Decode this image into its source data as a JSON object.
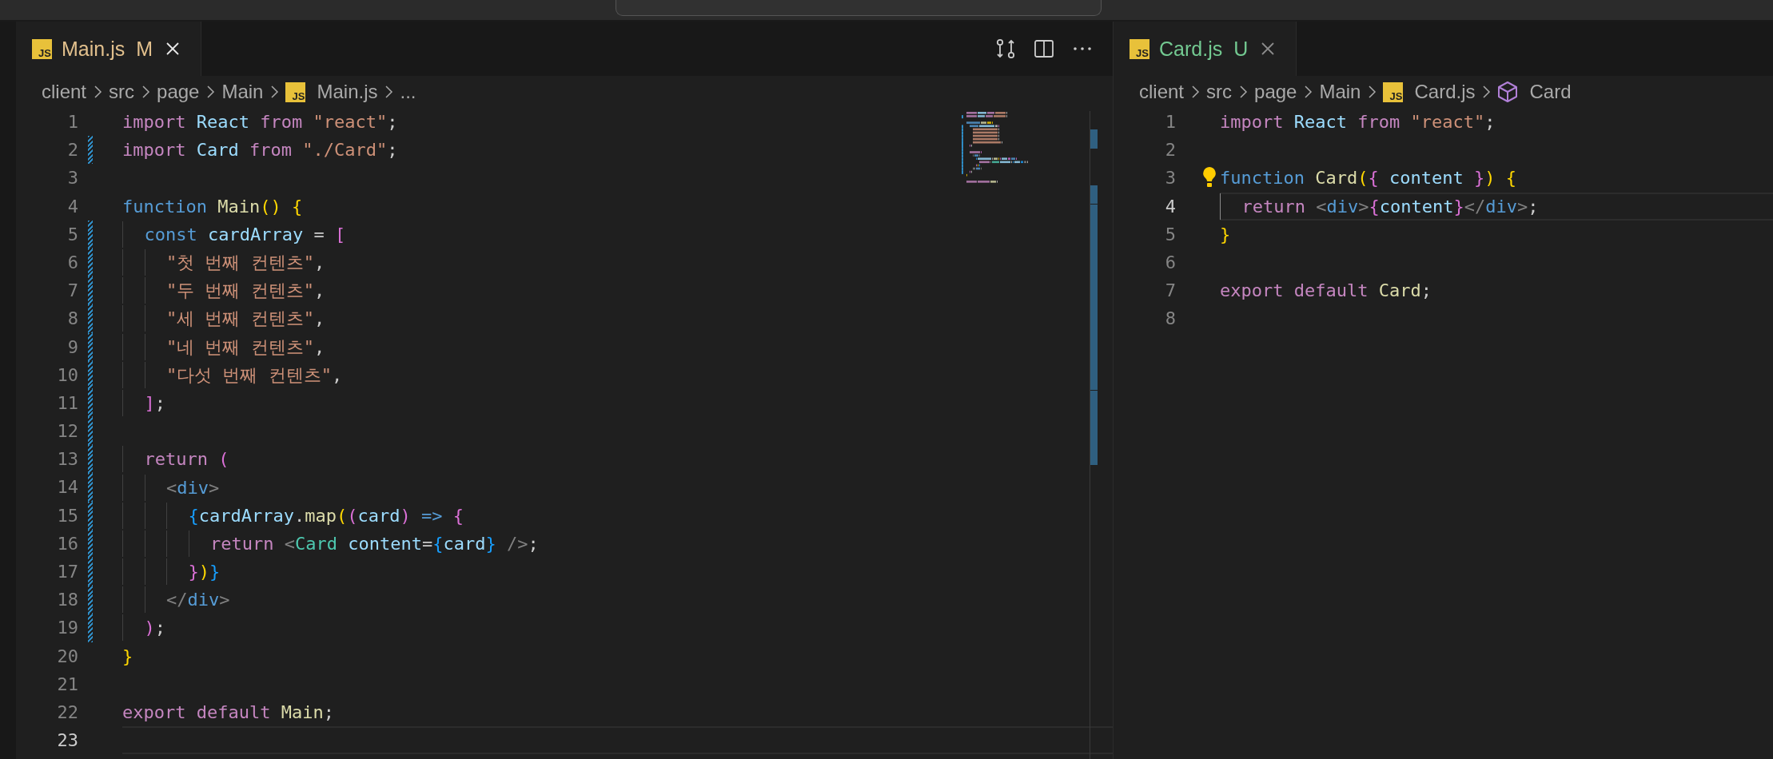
{
  "editor_groups": [
    {
      "focused": true,
      "tab": {
        "icon": "JS",
        "label": "Main.js",
        "status": "M",
        "kind": "modified",
        "selected": true
      },
      "actions": [
        {
          "kind": "compare"
        },
        {
          "kind": "split"
        },
        {
          "kind": "more"
        }
      ],
      "breadcrumbs": [
        {
          "kind": "folder",
          "label": "client"
        },
        {
          "kind": "folder",
          "label": "src"
        },
        {
          "kind": "folder",
          "label": "page"
        },
        {
          "kind": "folder",
          "label": "Main"
        },
        {
          "kind": "file",
          "icon": "JS",
          "label": "Main.js"
        },
        {
          "kind": "more",
          "label": "..."
        }
      ],
      "lines": [
        {
          "number": "1",
          "tokens": [
            {
              "kind": "kw",
              "text": "import "
            },
            {
              "kind": "var",
              "text": "React "
            },
            {
              "kind": "kw",
              "text": "from "
            },
            {
              "kind": "str",
              "text": "\"react\""
            },
            {
              "kind": "p",
              "text": ";"
            }
          ]
        },
        {
          "number": "2",
          "modified": true,
          "tokens": [
            {
              "kind": "kw",
              "text": "import "
            },
            {
              "kind": "var",
              "text": "Card "
            },
            {
              "kind": "kw",
              "text": "from "
            },
            {
              "kind": "str",
              "text": "\"./Card\""
            },
            {
              "kind": "p",
              "text": ";"
            }
          ]
        },
        {
          "number": "3"
        },
        {
          "number": "4",
          "tokens": [
            {
              "kind": "st",
              "text": "function "
            },
            {
              "kind": "fn",
              "text": "Main"
            },
            {
              "kind": "b1",
              "text": "() "
            },
            {
              "kind": "b1",
              "text": "{"
            }
          ]
        },
        {
          "number": "5",
          "modified": true,
          "tokens": [
            {
              "kind": "st",
              "text": "  const "
            },
            {
              "kind": "var",
              "text": "cardArray "
            },
            {
              "kind": "p",
              "text": "= "
            },
            {
              "kind": "b2",
              "text": "["
            }
          ]
        },
        {
          "number": "6",
          "modified": true,
          "tokens": [
            {
              "kind": "str",
              "text": "    \"첫 번째 컨텐츠\""
            },
            {
              "kind": "p",
              "text": ","
            }
          ]
        },
        {
          "number": "7",
          "modified": true,
          "tokens": [
            {
              "kind": "str",
              "text": "    \"두 번째 컨텐츠\""
            },
            {
              "kind": "p",
              "text": ","
            }
          ]
        },
        {
          "number": "8",
          "modified": true,
          "tokens": [
            {
              "kind": "str",
              "text": "    \"세 번째 컨텐츠\""
            },
            {
              "kind": "p",
              "text": ","
            }
          ]
        },
        {
          "number": "9",
          "modified": true,
          "tokens": [
            {
              "kind": "str",
              "text": "    \"네 번째 컨텐츠\""
            },
            {
              "kind": "p",
              "text": ","
            }
          ]
        },
        {
          "number": "10",
          "modified": true,
          "tokens": [
            {
              "kind": "str",
              "text": "    \"다섯 번째 컨텐츠\""
            },
            {
              "kind": "p",
              "text": ","
            }
          ]
        },
        {
          "number": "11",
          "modified": true,
          "tokens": [
            {
              "kind": "b2",
              "text": "  ]"
            },
            {
              "kind": "p",
              "text": ";"
            }
          ]
        },
        {
          "number": "12",
          "modified": true
        },
        {
          "number": "13",
          "modified": true,
          "tokens": [
            {
              "kind": "kw",
              "text": "  return "
            },
            {
              "kind": "b2",
              "text": "("
            }
          ]
        },
        {
          "number": "14",
          "modified": true,
          "tokens": [
            {
              "kind": "tag",
              "text": "    <"
            },
            {
              "kind": "tn",
              "text": "div"
            },
            {
              "kind": "tag",
              "text": ">"
            }
          ]
        },
        {
          "number": "15",
          "modified": true,
          "tokens": [
            {
              "kind": "b3",
              "text": "      {"
            },
            {
              "kind": "var",
              "text": "cardArray"
            },
            {
              "kind": "p",
              "text": "."
            },
            {
              "kind": "fn",
              "text": "map"
            },
            {
              "kind": "b1",
              "text": "("
            },
            {
              "kind": "b2",
              "text": "("
            },
            {
              "kind": "var",
              "text": "card"
            },
            {
              "kind": "b2",
              "text": ") "
            },
            {
              "kind": "st",
              "text": "=> "
            },
            {
              "kind": "b2",
              "text": "{"
            }
          ]
        },
        {
          "number": "16",
          "modified": true,
          "tokens": [
            {
              "kind": "kw",
              "text": "        return "
            },
            {
              "kind": "tag",
              "text": "<"
            },
            {
              "kind": "cmp",
              "text": "Card "
            },
            {
              "kind": "var",
              "text": "content"
            },
            {
              "kind": "p",
              "text": "="
            },
            {
              "kind": "b3",
              "text": "{"
            },
            {
              "kind": "var",
              "text": "card"
            },
            {
              "kind": "b3",
              "text": "} "
            },
            {
              "kind": "tag",
              "text": "/>"
            },
            {
              "kind": "p",
              "text": ";"
            }
          ]
        },
        {
          "number": "17",
          "modified": true,
          "tokens": [
            {
              "kind": "b2",
              "text": "      }"
            },
            {
              "kind": "b1",
              "text": ")"
            },
            {
              "kind": "b3",
              "text": "}"
            }
          ]
        },
        {
          "number": "18",
          "modified": true,
          "tokens": [
            {
              "kind": "tag",
              "text": "    </"
            },
            {
              "kind": "tn",
              "text": "div"
            },
            {
              "kind": "tag",
              "text": ">"
            }
          ]
        },
        {
          "number": "19",
          "modified": true,
          "tokens": [
            {
              "kind": "b2",
              "text": "  )"
            },
            {
              "kind": "p",
              "text": ";"
            }
          ]
        },
        {
          "number": "20",
          "tokens": [
            {
              "kind": "b1",
              "text": "}"
            }
          ]
        },
        {
          "number": "21"
        },
        {
          "number": "22",
          "tokens": [
            {
              "kind": "kw",
              "text": "export "
            },
            {
              "kind": "kw",
              "text": "default "
            },
            {
              "kind": "fn",
              "text": "Main"
            },
            {
              "kind": "p",
              "text": ";"
            }
          ]
        },
        {
          "number": "23",
          "current": true
        }
      ]
    },
    {
      "focused": false,
      "tab": {
        "icon": "JS",
        "label": "Card.js",
        "status": "U",
        "kind": "untracked",
        "selected": true
      },
      "breadcrumbs": [
        {
          "kind": "folder",
          "label": "client"
        },
        {
          "kind": "folder",
          "label": "src"
        },
        {
          "kind": "folder",
          "label": "page"
        },
        {
          "kind": "folder",
          "label": "Main"
        },
        {
          "kind": "file",
          "icon": "JS",
          "label": "Card.js"
        },
        {
          "kind": "symbol",
          "label": "Card"
        }
      ],
      "lines": [
        {
          "number": "1",
          "tokens": [
            {
              "kind": "kw",
              "text": "import "
            },
            {
              "kind": "var",
              "text": "React "
            },
            {
              "kind": "kw",
              "text": "from "
            },
            {
              "kind": "str",
              "text": "\"react\""
            },
            {
              "kind": "p",
              "text": ";"
            }
          ]
        },
        {
          "number": "2"
        },
        {
          "number": "3",
          "lightbulb": true,
          "tokens": [
            {
              "kind": "st",
              "text": "function "
            },
            {
              "kind": "fn",
              "text": "Card"
            },
            {
              "kind": "b1",
              "text": "("
            },
            {
              "kind": "b2",
              "text": "{ "
            },
            {
              "kind": "var",
              "text": "content "
            },
            {
              "kind": "b2",
              "text": "}"
            },
            {
              "kind": "b1",
              "text": ") "
            },
            {
              "kind": "b1",
              "text": "{"
            }
          ]
        },
        {
          "number": "4",
          "current": true,
          "tokens": [
            {
              "kind": "kw",
              "text": "  return "
            },
            {
              "kind": "tag",
              "text": "<"
            },
            {
              "kind": "tn",
              "text": "div"
            },
            {
              "kind": "tag",
              "text": ">"
            },
            {
              "kind": "b2",
              "text": "{"
            },
            {
              "kind": "var",
              "text": "content"
            },
            {
              "kind": "b2",
              "text": "}"
            },
            {
              "kind": "tag",
              "text": "</"
            },
            {
              "kind": "tn",
              "text": "div"
            },
            {
              "kind": "tag",
              "text": ">"
            },
            {
              "kind": "p",
              "text": ";"
            }
          ]
        },
        {
          "number": "5",
          "tokens": [
            {
              "kind": "b1",
              "text": "}"
            }
          ]
        },
        {
          "number": "6"
        },
        {
          "number": "7",
          "tokens": [
            {
              "kind": "kw",
              "text": "export "
            },
            {
              "kind": "kw",
              "text": "default "
            },
            {
              "kind": "fn",
              "text": "Card"
            },
            {
              "kind": "p",
              "text": ";"
            }
          ]
        },
        {
          "number": "8"
        }
      ]
    }
  ]
}
